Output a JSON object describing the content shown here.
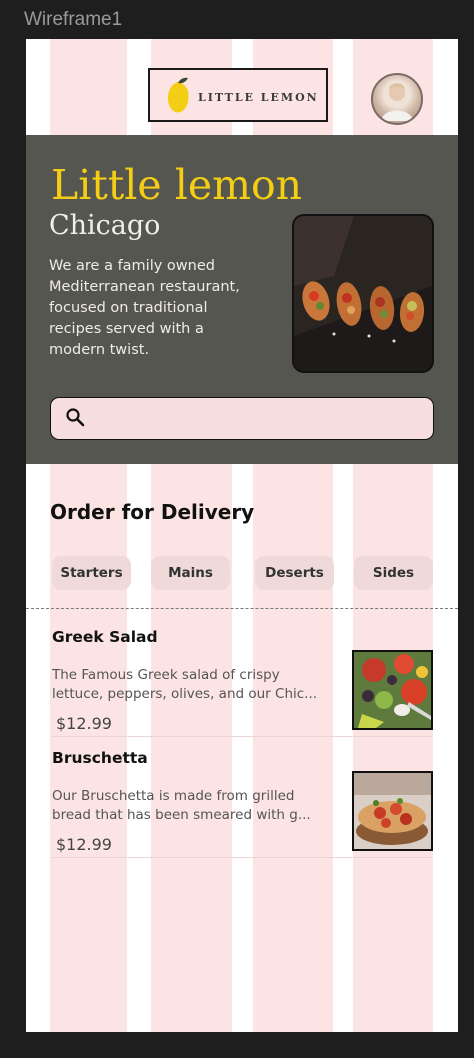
{
  "canvas": {
    "frame_label": "Wireframe1"
  },
  "header": {
    "logo_text": "LITTLE LEMON",
    "logo_icon": "lemon-icon",
    "avatar_icon": "chef-avatar"
  },
  "hero": {
    "title": "Little lemon",
    "subtitle": "Chicago",
    "description_lines": [
      "We are a family owned",
      "Mediterranean restaurant,",
      "focused on traditional",
      "recipes served with a",
      "modern twist."
    ],
    "image_icon": "bruschetta-platter-image",
    "search_icon": "search-icon"
  },
  "order": {
    "title": "Order for Delivery",
    "categories": [
      "Starters",
      "Mains",
      "Deserts",
      "Sides"
    ]
  },
  "menu": [
    {
      "name": "Greek Salad",
      "desc_lines": [
        "The Famous Greek salad of crispy",
        "lettuce, peppers, olives, and our Chic..."
      ],
      "price": "$12.99",
      "image_icon": "greek-salad-image"
    },
    {
      "name": "Bruschetta",
      "desc_lines": [
        "Our Bruschetta is made from grilled",
        "bread that has been smeared with g..."
      ],
      "price": "$12.99",
      "image_icon": "bruschetta-image"
    }
  ],
  "colors": {
    "primary_green": "#495e57",
    "primary_yellow": "#f4ce14",
    "grid_pink": "#fbe4e3",
    "canvas_bg": "#1e1e1e"
  }
}
